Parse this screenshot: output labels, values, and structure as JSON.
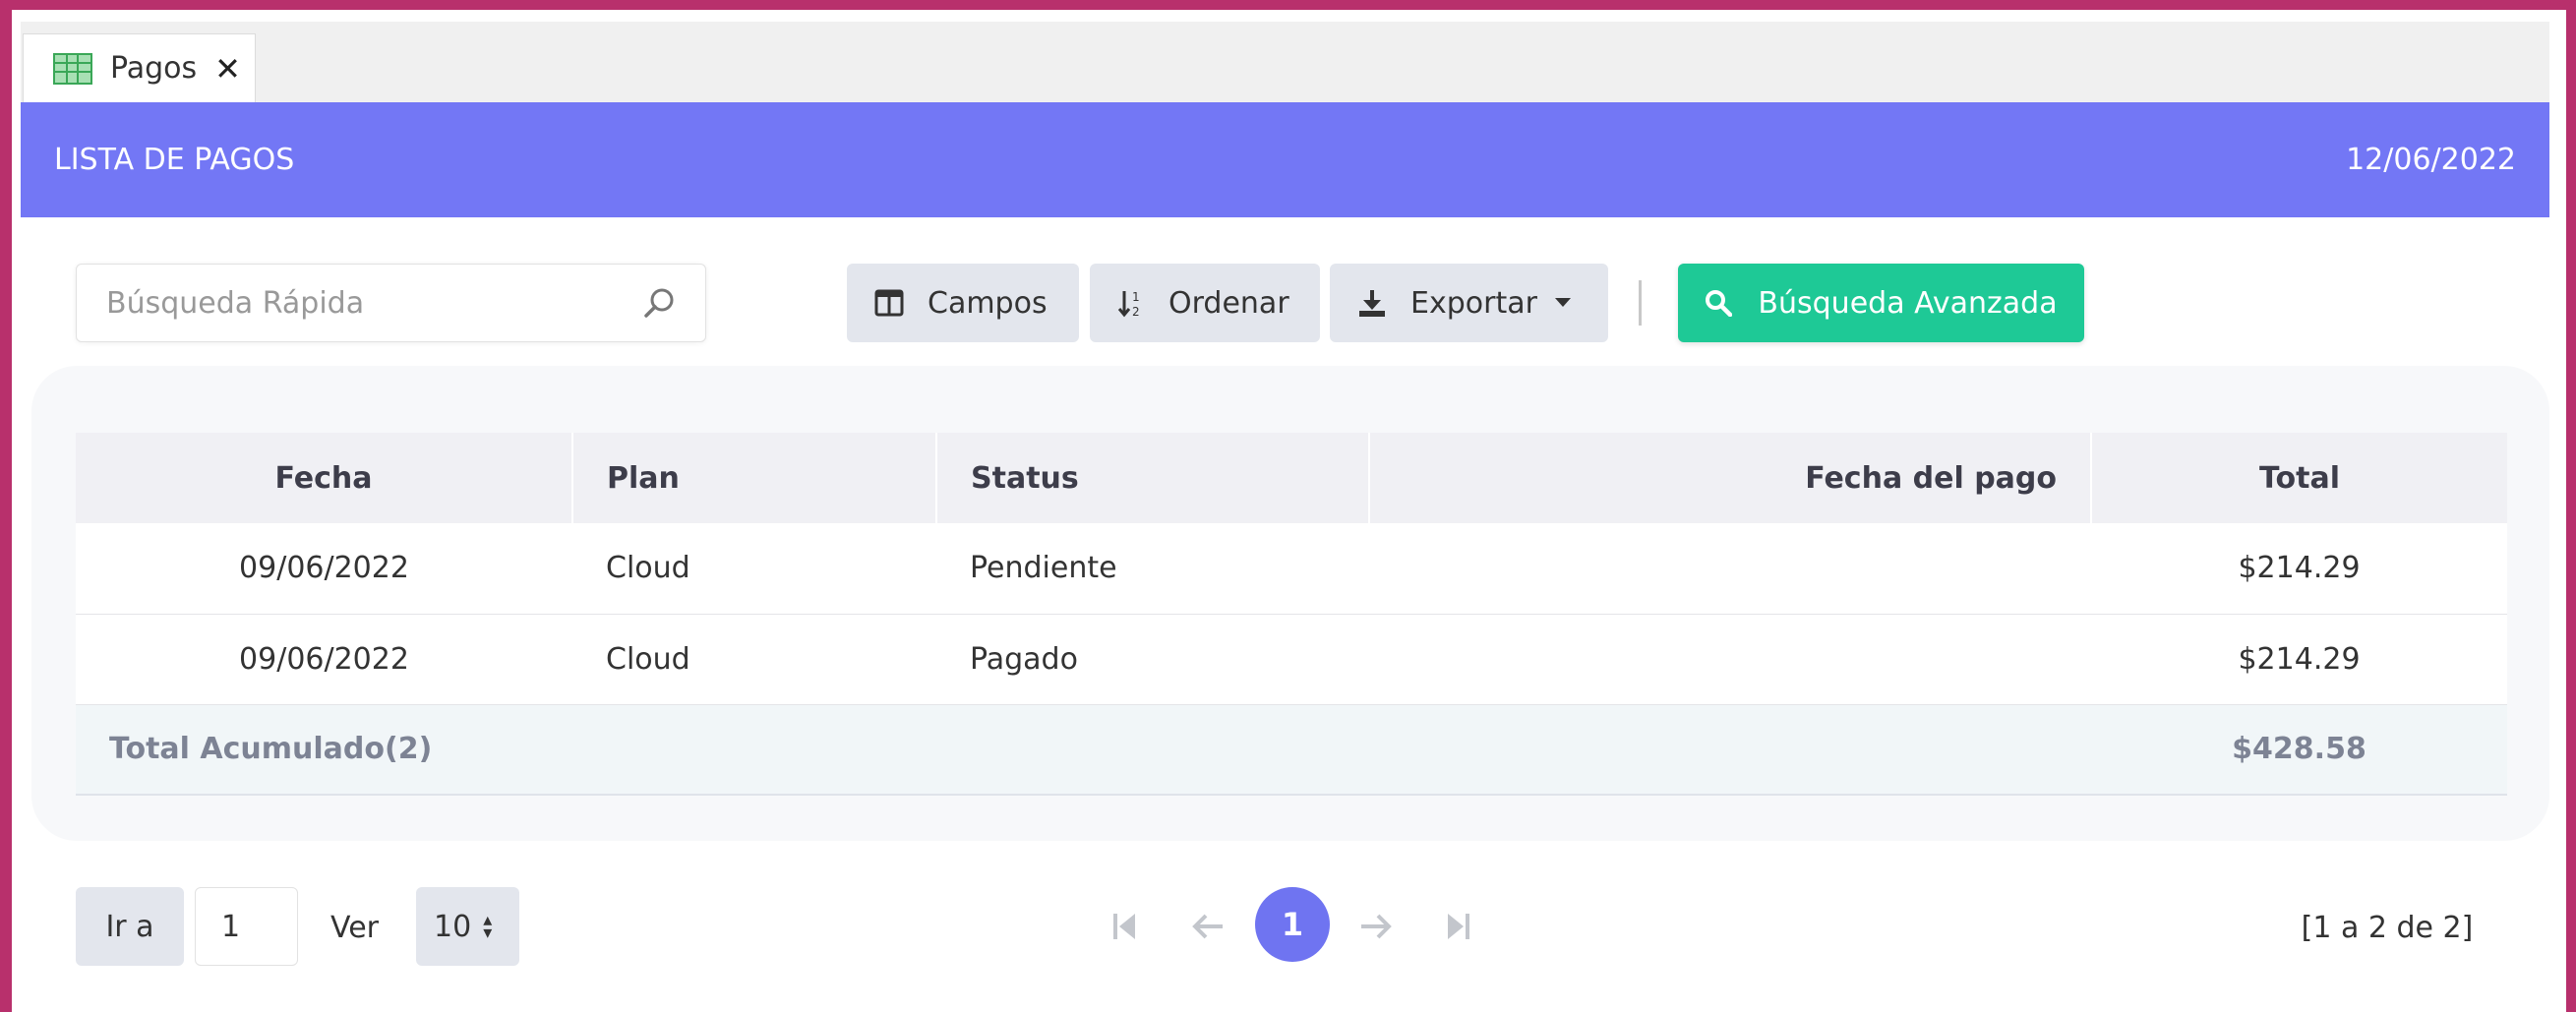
{
  "tab": {
    "label": "Pagos",
    "icon": "spreadsheet-icon",
    "close_label": "✕"
  },
  "header": {
    "title": "LISTA DE PAGOS",
    "date": "12/06/2022"
  },
  "toolbar": {
    "search_placeholder": "Búsqueda Rápida",
    "fields_label": "Campos",
    "sort_label": "Ordenar",
    "export_label": "Exportar",
    "advanced_search_label": "Búsqueda Avanzada"
  },
  "table": {
    "columns": [
      "Fecha",
      "Plan",
      "Status",
      "Fecha del pago",
      "Total"
    ],
    "rows": [
      [
        "09/06/2022",
        "Cloud",
        "Pendiente",
        "",
        "$214.29"
      ],
      [
        "09/06/2022",
        "Cloud",
        "Pagado",
        "",
        "$214.29"
      ]
    ],
    "total_label": "Total Acumulado(2)",
    "total_value": "$428.58"
  },
  "pagination": {
    "goto_label": "Ir a",
    "goto_value": "1",
    "view_label": "Ver",
    "page_size": "10",
    "current_page": "1",
    "range_text": "[1 a 2 de 2]"
  },
  "colors": {
    "header": "#7377f5",
    "accent_green": "#1ec996",
    "page_active": "#6f74f1"
  }
}
